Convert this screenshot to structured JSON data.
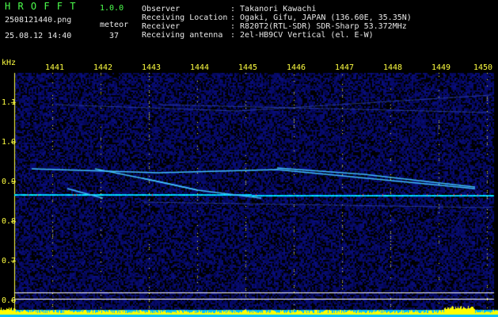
{
  "header": {
    "logo": "H R O F F T",
    "version": "1.0.0",
    "filename": "2508121440.png",
    "datetime": "25.08.12 14:40",
    "meteor_label": "meteor",
    "meteor_count": "37"
  },
  "info": {
    "rows": [
      {
        "label": "Observer",
        "value": ": Takanori Kawachi"
      },
      {
        "label": "Receiving Location",
        "value": ": Ogaki, Gifu, JAPAN (136.60E, 35.35N)"
      },
      {
        "label": "Receiver",
        "value": ": R820T2(RTL-SDR) SDR-Sharp 53.372MHz"
      },
      {
        "label": "Receiving antenna",
        "value": ": 2el-HB9CV Vertical (el. E-W)"
      }
    ]
  },
  "time_axis": {
    "labels": [
      "1441",
      "1442",
      "1443",
      "1444",
      "1445",
      "1446",
      "1447",
      "1448",
      "1449",
      "1450"
    ]
  },
  "freq_axis": {
    "unit": "kHz",
    "labels": [
      "1.1",
      "1.0",
      "0.9",
      "0.8",
      "0.7",
      "0.6"
    ]
  },
  "colors": {
    "background": "#000000",
    "noise": "#0a0a5a",
    "carrier": "#00e0ff",
    "echo": "#40c0ff",
    "grid": "#ffff40",
    "ref_line": "#ffffff",
    "baseline": "#00c0ff",
    "activity": "#ffff00"
  }
}
